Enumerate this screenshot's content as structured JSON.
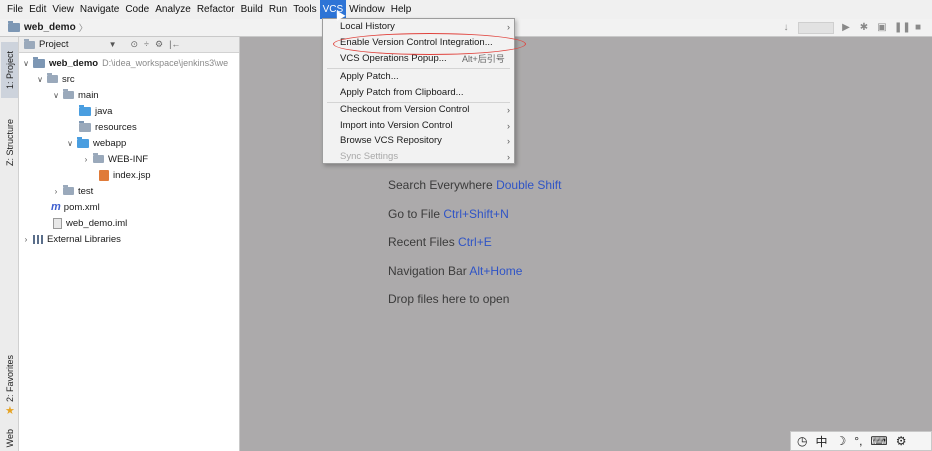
{
  "menubar": {
    "items": [
      "File",
      "Edit",
      "View",
      "Navigate",
      "Code",
      "Analyze",
      "Refactor",
      "Build",
      "Run",
      "Tools",
      "VCS",
      "Window",
      "Help"
    ],
    "active": "VCS"
  },
  "navbar": {
    "project": "web_demo"
  },
  "left_strip": {
    "tabs": [
      "1: Project",
      "Z: Structure",
      "2: Favorites",
      "Web"
    ]
  },
  "project_panel": {
    "header": "Project",
    "tree": [
      {
        "label": "web_demo",
        "path": "D:\\idea_workspace\\jenkins3\\we",
        "bold": true
      },
      {
        "label": "src"
      },
      {
        "label": "main"
      },
      {
        "label": "java"
      },
      {
        "label": "resources"
      },
      {
        "label": "webapp"
      },
      {
        "label": "WEB-INF"
      },
      {
        "label": "index.jsp"
      },
      {
        "label": "test"
      },
      {
        "label": "pom.xml"
      },
      {
        "label": "web_demo.iml"
      },
      {
        "label": "External Libraries"
      }
    ]
  },
  "editor_hints": [
    {
      "text": "Search Everywhere",
      "key": "Double Shift"
    },
    {
      "text": "Go to File",
      "key": "Ctrl+Shift+N"
    },
    {
      "text": "Recent Files",
      "key": "Ctrl+E"
    },
    {
      "text": "Navigation Bar",
      "key": "Alt+Home"
    },
    {
      "text": "Drop files here to open",
      "key": ""
    }
  ],
  "vcs_menu": {
    "items": [
      {
        "label": "Local History",
        "submenu": true
      },
      {
        "label": "Enable Version Control Integration...",
        "highlighted": true
      },
      {
        "label": "VCS Operations Popup...",
        "shortcut": "Alt+后引号"
      },
      {
        "label": "Apply Patch..."
      },
      {
        "label": "Apply Patch from Clipboard..."
      },
      {
        "label": "Checkout from Version Control",
        "submenu": true
      },
      {
        "label": "Import into Version Control",
        "submenu": true
      },
      {
        "label": "Browse VCS Repository",
        "submenu": true
      },
      {
        "label": "Sync Settings",
        "submenu": true,
        "disabled": true
      }
    ],
    "highlight_color": "#e0423c"
  },
  "ime_bar": {
    "glyphs": [
      "中",
      "☽",
      "°,",
      "⌨",
      "⚙"
    ]
  },
  "colors": {
    "accent": "#2d74d6",
    "editor_bg": "#acaaab",
    "shortcut": "#2f54c6"
  }
}
